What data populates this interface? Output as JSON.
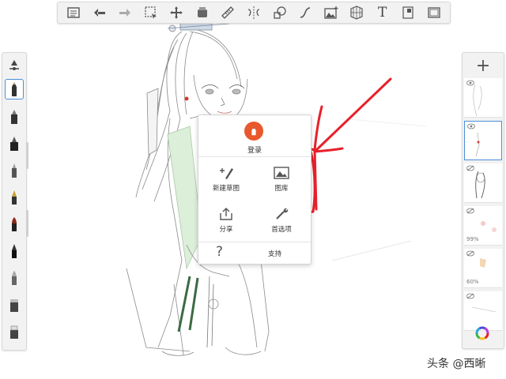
{
  "toolbar": {
    "tools": [
      "list-icon",
      "undo-icon",
      "redo-icon",
      "selection-icon",
      "transform-icon",
      "symmetry-stencil-icon",
      "ruler-icon",
      "mirror-icon",
      "shapes-icon",
      "curve-icon",
      "image-import-icon",
      "perspective-grid-icon",
      "text-icon",
      "fill-icon",
      "fullscreen-icon"
    ],
    "text_tool_label": "T"
  },
  "brushes": {
    "items": [
      "adjust-icon",
      "pencil-icon",
      "marker-icon",
      "ballpoint-icon",
      "airbrush-icon",
      "fountain-pen-icon",
      "ink-brush-icon",
      "calligraphy-icon",
      "paint-brush-icon",
      "eraser-icon",
      "smudge-icon"
    ],
    "selected_index": 1
  },
  "layers": {
    "add_label": "+",
    "items": [
      {
        "name": "layer-1",
        "visible": true,
        "opacity": ""
      },
      {
        "name": "layer-2",
        "visible": true,
        "opacity": "",
        "selected": true
      },
      {
        "name": "layer-3",
        "visible": false,
        "opacity": ""
      },
      {
        "name": "layer-4",
        "visible": false,
        "opacity": "99%"
      },
      {
        "name": "layer-5",
        "visible": false,
        "opacity": "60%"
      },
      {
        "name": "layer-6",
        "visible": false,
        "opacity": ""
      }
    ]
  },
  "menu": {
    "login_label": "登录",
    "new_sketch_label": "新建草图",
    "gallery_label": "图库",
    "share_label": "分享",
    "preferences_label": "首选项",
    "support_icon": "?",
    "support_label": "支持"
  },
  "watermark": "头条 @西晰",
  "colors": {
    "accent": "#4a90d9",
    "avatar": "#e8582c",
    "annotation": "#e8202a",
    "robe_green": "#3c6a44",
    "toolbar_bg": "#f2f2f2"
  }
}
